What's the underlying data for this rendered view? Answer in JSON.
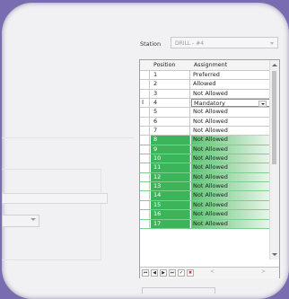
{
  "station": {
    "label": "Station",
    "value": "DRILL - #4"
  },
  "grid": {
    "columns": [
      "Position",
      "Assignment"
    ],
    "rows": [
      {
        "position": "1",
        "assignment": "Preferred",
        "green": false
      },
      {
        "position": "2",
        "assignment": "Allowed",
        "green": false
      },
      {
        "position": "3",
        "assignment": "Not Allowed",
        "green": false
      },
      {
        "position": "4",
        "assignment": "Mandatory",
        "green": false,
        "editing": true
      },
      {
        "position": "5",
        "assignment": "Not Allowed",
        "green": false
      },
      {
        "position": "6",
        "assignment": "Not Allowed",
        "green": false
      },
      {
        "position": "7",
        "assignment": "Not Allowed",
        "green": false
      },
      {
        "position": "8",
        "assignment": "Not Allowed",
        "green": true
      },
      {
        "position": "9",
        "assignment": "Not Allowed",
        "green": true
      },
      {
        "position": "10",
        "assignment": "Not Allowed",
        "green": true
      },
      {
        "position": "11",
        "assignment": "Not Allowed",
        "green": true
      },
      {
        "position": "12",
        "assignment": "Not Allowed",
        "green": true
      },
      {
        "position": "13",
        "assignment": "Not Allowed",
        "green": true
      },
      {
        "position": "14",
        "assignment": "Not Allowed",
        "green": true
      },
      {
        "position": "15",
        "assignment": "Not Allowed",
        "green": true
      },
      {
        "position": "16",
        "assignment": "Not Allowed",
        "green": true
      },
      {
        "position": "17",
        "assignment": "Not Allowed",
        "green": true
      }
    ],
    "cursor_glyph": "I"
  },
  "navigator": {
    "first": "⏮",
    "prev": "◀",
    "next": "▶",
    "last": "⏭",
    "apply": "✔",
    "cancel": "✖",
    "scroll_left": "<",
    "scroll_right": ">"
  },
  "colors": {
    "green": "#3cb55a",
    "background": "#7a6cb0",
    "apply": "#2e9b2e",
    "cancel": "#d02020"
  }
}
